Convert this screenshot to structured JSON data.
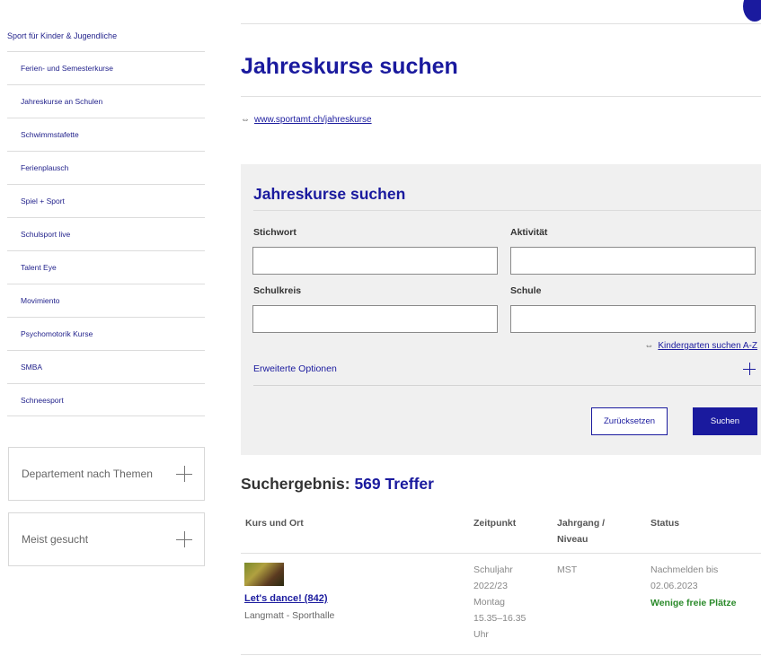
{
  "sidebar": {
    "top_label": "Sport für Kinder & Jugendliche",
    "items": [
      {
        "label": "Ferien- und Semesterkurse"
      },
      {
        "label": "Jahreskurse an Schulen"
      },
      {
        "label": "Schwimmstafette"
      },
      {
        "label": "Ferienplausch"
      },
      {
        "label": "Spiel + Sport"
      },
      {
        "label": "Schulsport live"
      },
      {
        "label": "Talent Eye"
      },
      {
        "label": "Movimiento"
      },
      {
        "label": "Psychomotorik Kurse"
      },
      {
        "label": "SMBA"
      },
      {
        "label": "Schneesport"
      }
    ],
    "boxes": [
      {
        "label": "Departement nach Themen"
      },
      {
        "label": "Meist gesucht"
      }
    ]
  },
  "main": {
    "title": "Jahreskurse suchen",
    "link": "www.sportamt.ch/jahreskurse"
  },
  "search": {
    "title": "Jahreskurse suchen",
    "fields": [
      {
        "label": "Stichwort",
        "value": ""
      },
      {
        "label": "Aktivität",
        "value": ""
      },
      {
        "label": "Schulkreis",
        "value": ""
      },
      {
        "label": "Schule",
        "value": ""
      }
    ],
    "kindergarten_link": "Kindergarten suchen A-Z",
    "advanced_label": "Erweiterte Optionen",
    "reset_label": "Zurücksetzen",
    "search_label": "Suchen"
  },
  "results": {
    "label": "Suchergebnis:",
    "count": "569 Treffer",
    "columns": [
      "Kurs und Ort",
      "Zeitpunkt",
      "Jahrgang / Niveau",
      "Status"
    ],
    "rows": [
      {
        "course": "Let's dance! (842)",
        "location": "Langmatt - Sporthalle",
        "time": "Schuljahr 2022/23 Montag 15.35–16.35 Uhr",
        "level": "MST",
        "status": "Nachmelden bis 02.06.2023",
        "availability": "Wenige freie Plätze"
      }
    ]
  },
  "colors": {
    "accent": "#1a1a9e",
    "panel_bg": "#f0f0f0",
    "available": "#2a8a2a"
  }
}
